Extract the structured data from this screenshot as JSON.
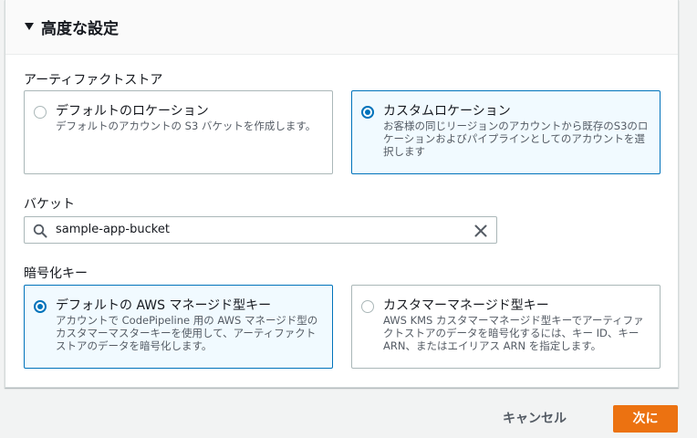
{
  "section": {
    "title": "高度な設定"
  },
  "artifact_store": {
    "label": "アーティファクトストア",
    "options": [
      {
        "title": "デフォルトのロケーション",
        "description": "デフォルトのアカウントの S3 バケットを作成します。",
        "selected": false
      },
      {
        "title": "カスタムロケーション",
        "description": "お客様の同じリージョンのアカウントから既存のS3のロケーションおよびパイプラインとしてのアカウントを選択します",
        "selected": true
      }
    ]
  },
  "bucket": {
    "label": "バケット",
    "value": "sample-app-bucket"
  },
  "encryption_key": {
    "label": "暗号化キー",
    "options": [
      {
        "title": "デフォルトの AWS マネージド型キー",
        "description": "アカウントで CodePipeline 用の AWS マネージド型のカスタマーマスターキーを使用して、アーティファクトストアのデータを暗号化します。",
        "selected": true
      },
      {
        "title": "カスタマーマネージド型キー",
        "description": "AWS KMS カスタマーマネージド型キーでアーティファクトストアのデータを暗号化するには、キー ID、キー ARN、またはエイリアス ARN を指定します。",
        "selected": false
      }
    ]
  },
  "footer": {
    "cancel_label": "キャンセル",
    "next_label": "次に"
  },
  "colors": {
    "accent": "#0073bb",
    "primary_button": "#ec7211"
  }
}
